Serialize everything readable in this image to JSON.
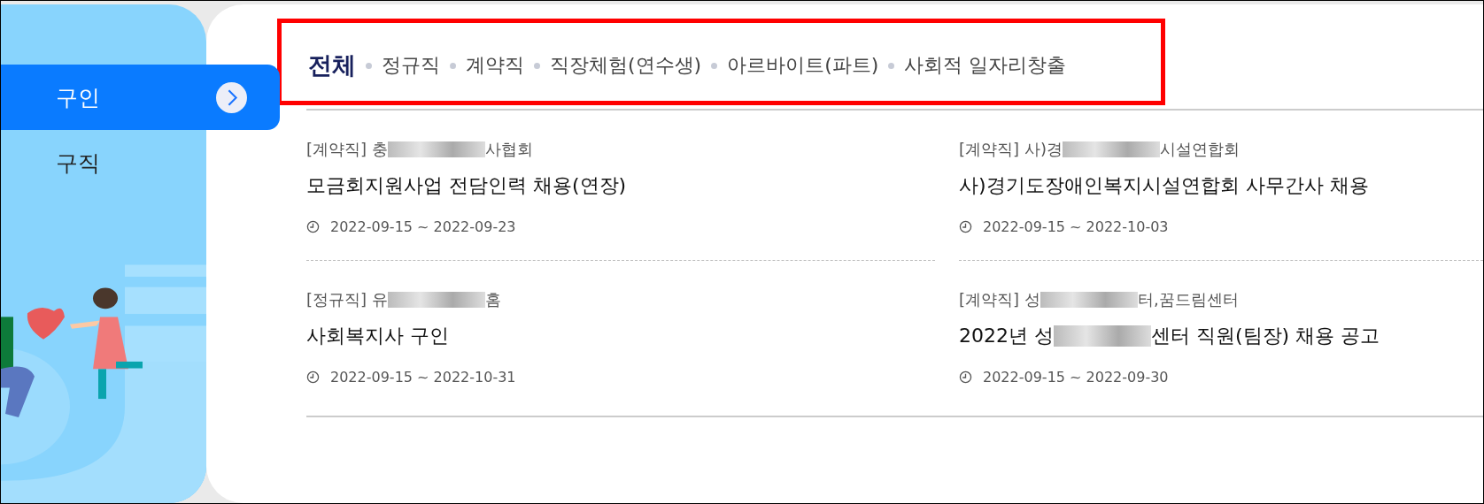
{
  "sidebar": {
    "items": [
      {
        "label": "구인",
        "selected": true
      },
      {
        "label": "구직",
        "selected": false
      }
    ]
  },
  "tabs": [
    {
      "label": "전체",
      "selected": true
    },
    {
      "label": "정규직",
      "selected": false
    },
    {
      "label": "계약직",
      "selected": false
    },
    {
      "label": "직장체험(연수생)",
      "selected": false
    },
    {
      "label": "아르바이트(파트)",
      "selected": false
    },
    {
      "label": "사회적 일자리창출",
      "selected": false
    }
  ],
  "posts": [
    {
      "category": "[계약직]",
      "organization": [
        "충",
        "사협회"
      ],
      "title": [
        "모금회지원사업 전담인력 채용(연장)"
      ],
      "period": "2022-09-15 ~ 2022-09-23"
    },
    {
      "category": "[계약직]",
      "organization": [
        "사)경",
        "시설연합회"
      ],
      "title": [
        "사)경기도장애인복지시설연합회 사무간사 채용"
      ],
      "period": "2022-09-15 ~ 2022-10-03"
    },
    {
      "category": "[정규직]",
      "organization": [
        "유",
        "홈"
      ],
      "title": [
        "사회복지사 구인"
      ],
      "period": "2022-09-15 ~ 2022-10-31"
    },
    {
      "category": "[계약직]",
      "organization": [
        "성",
        "터,꿈드림센터"
      ],
      "title": [
        "2022년 성",
        "센터 직원(팀장) 채용 공고"
      ],
      "period": "2022-09-15 ~ 2022-09-30"
    }
  ]
}
